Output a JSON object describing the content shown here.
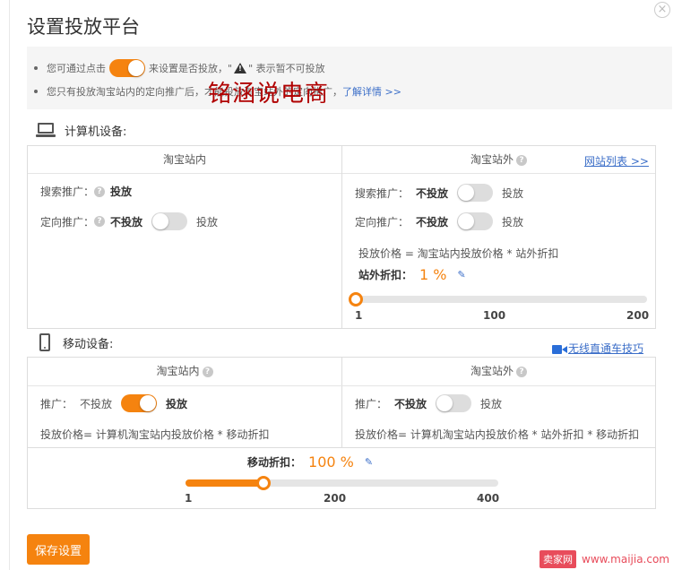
{
  "dialog": {
    "title": "设置投放平台",
    "close_glyph": "×"
  },
  "notice": {
    "line1_before": "您可通过点击",
    "line1_toggle_on": true,
    "line1_mid": "来设置是否投放，\"",
    "line1_after": "\" 表示暂不可投放",
    "line2_text": "您只有投放淘宝站内的定向推广后，才能投放淘宝站外的定向推广，",
    "line2_link": "了解详情 >>",
    "icon": "warning-triangle-icon"
  },
  "watermark": "铭涵说电商",
  "pc": {
    "heading": "计算机设备:",
    "icon": "computer-icon",
    "inner": {
      "header": "淘宝站内",
      "search_label": "搜索推广：",
      "search_value": "投放",
      "targeted_label": "定向推广：",
      "targeted_off": "不投放",
      "targeted_on": "投放",
      "targeted_toggle_on": false
    },
    "outer": {
      "header": "淘宝站外",
      "site_list_link": "网站列表 >>",
      "search_label": "搜索推广：",
      "search_off": "不投放",
      "search_on": "投放",
      "search_toggle_on": false,
      "targeted_label": "定向推广：",
      "targeted_off": "不投放",
      "targeted_on": "投放",
      "targeted_toggle_on": false,
      "formula": "投放价格 = 淘宝站内投放价格 * 站外折扣",
      "discount_label": "站外折扣：",
      "discount_value": "1 %",
      "slider_value": 1,
      "slider_min": 1,
      "slider_max": 200,
      "ticks": [
        "1",
        "100",
        "200"
      ]
    }
  },
  "mobile": {
    "heading": "移动设备:",
    "icon": "mobile-phone-icon",
    "tips_link": "无线直通车技巧",
    "inner": {
      "header": "淘宝站内",
      "promo_label": "推广：",
      "promo_off": "不投放",
      "promo_on": "投放",
      "promo_toggle_on": true,
      "formula": "投放价格= 计算机淘宝站内投放价格 * 移动折扣"
    },
    "outer": {
      "header": "淘宝站外",
      "promo_label": "推广：",
      "promo_off": "不投放",
      "promo_on": "投放",
      "promo_toggle_on": false,
      "formula": "投放价格= 计算机淘宝站内投放价格 * 站外折扣 * 移动折扣"
    },
    "discount_label": "移动折扣：",
    "discount_value": "100 %",
    "slider_value": 100,
    "slider_min": 1,
    "slider_max": 400,
    "ticks": [
      "1",
      "200",
      "400"
    ]
  },
  "footer": {
    "save_label": "保存设置"
  },
  "brand": {
    "tag": "卖家网",
    "url": "www.maijia.com"
  },
  "colors": {
    "accent": "#f5830f",
    "link": "#3b6ec8",
    "watermark": "#b00000",
    "brand": "#e84c5b"
  }
}
